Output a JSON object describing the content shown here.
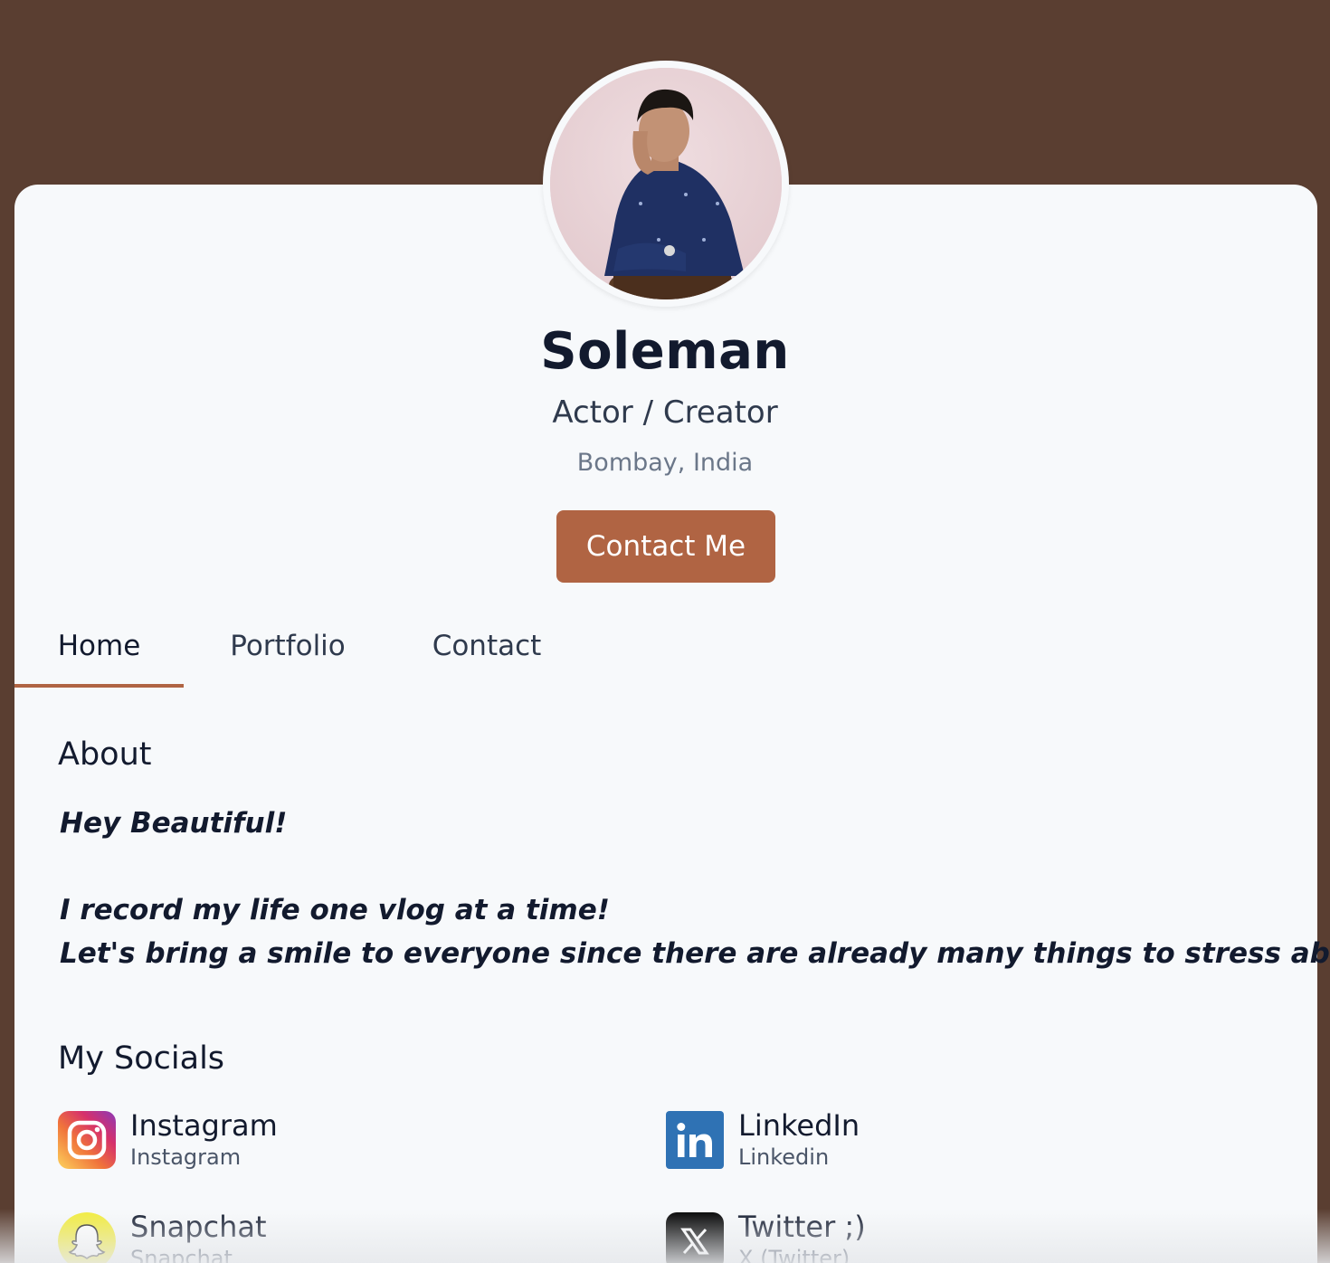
{
  "profile": {
    "name": "Soleman",
    "subtitle": "Actor / Creator",
    "location": "Bombay, India",
    "contact_button": "Contact Me"
  },
  "tabs": [
    {
      "label": "Home",
      "active": true
    },
    {
      "label": "Portfolio",
      "active": false
    },
    {
      "label": "Contact",
      "active": false
    }
  ],
  "about": {
    "title": "About",
    "lines": [
      "Hey Beautiful!",
      "I record my life one vlog at a time!",
      "Let's bring a smile to everyone since there are already many things to stress about!"
    ]
  },
  "socials": {
    "title": "My Socials",
    "items": [
      {
        "name": "Instagram",
        "sub": "Instagram",
        "icon": "instagram-icon"
      },
      {
        "name": "LinkedIn",
        "sub": "Linkedin",
        "icon": "linkedin-icon"
      },
      {
        "name": "Snapchat",
        "sub": "Snapchat",
        "icon": "snapchat-icon"
      },
      {
        "name": "Twitter ;)",
        "sub": "X (Twitter)",
        "icon": "x-twitter-icon"
      }
    ]
  },
  "colors": {
    "background": "#5a3e31",
    "card": "#f7f9fb",
    "accent": "#b06443",
    "text_primary": "#121a2e"
  }
}
